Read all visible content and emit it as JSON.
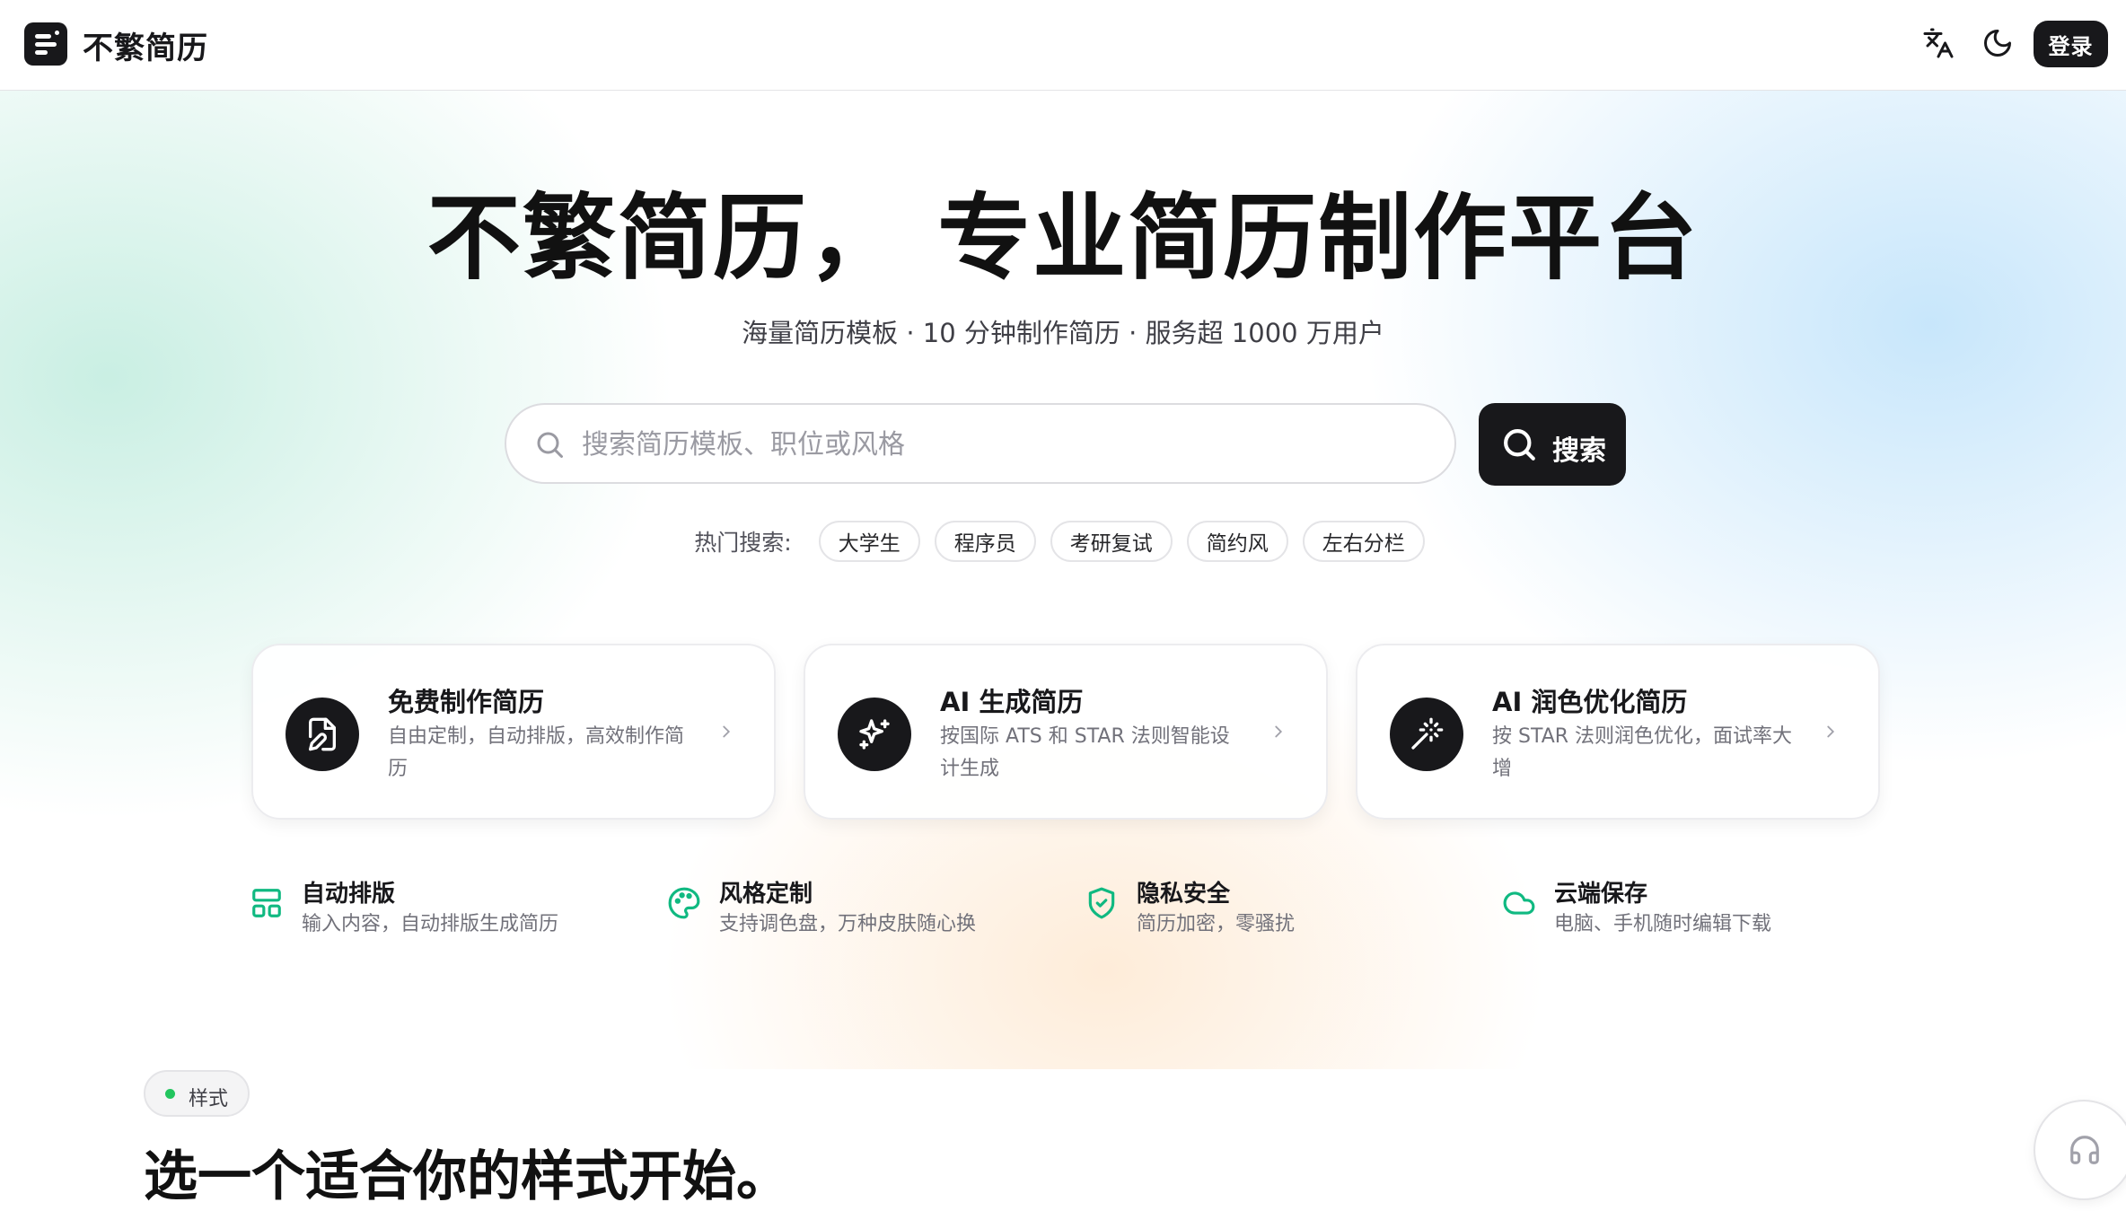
{
  "header": {
    "brand": "不繁简历",
    "icons": [
      "language-icon",
      "moon-icon"
    ],
    "login_label": "登录"
  },
  "hero": {
    "title": "不繁简历， 专业简历制作平台",
    "subtitle": "海量简历模板 · 10 分钟制作简历 · 服务超 1000 万用户"
  },
  "search": {
    "placeholder": "搜索简历模板、职位或风格",
    "value": "",
    "button_label": "搜索",
    "hot_label": "热门搜索:",
    "hot_tags": [
      "大学生",
      "程序员",
      "考研复试",
      "简约风",
      "左右分栏"
    ]
  },
  "cards": [
    {
      "icon": "file-edit-icon",
      "title": "免费制作简历",
      "desc": "自由定制，自动排版，高效制作简历"
    },
    {
      "icon": "sparkles-icon",
      "title": "AI 生成简历",
      "desc": "按国际 ATS 和 STAR 法则智能设计生成"
    },
    {
      "icon": "magic-wand-icon",
      "title": "AI 润色优化简历",
      "desc": "按 STAR 法则润色优化，面试率大增"
    }
  ],
  "features": [
    {
      "icon": "layout-icon",
      "title": "自动排版",
      "desc": "输入内容，自动排版生成简历"
    },
    {
      "icon": "palette-icon",
      "title": "风格定制",
      "desc": "支持调色盘，万种皮肤随心换"
    },
    {
      "icon": "shield-check-icon",
      "title": "隐私安全",
      "desc": "简历加密，零骚扰"
    },
    {
      "icon": "cloud-icon",
      "title": "云端保存",
      "desc": "电脑、手机随时编辑下载"
    }
  ],
  "section": {
    "badge": "样式",
    "title": "选一个适合你的样式开始。"
  },
  "colors": {
    "primary": "#18181b",
    "accent_green": "#10b981",
    "badge_dot": "#22c55e",
    "muted_text": "#71717a"
  }
}
